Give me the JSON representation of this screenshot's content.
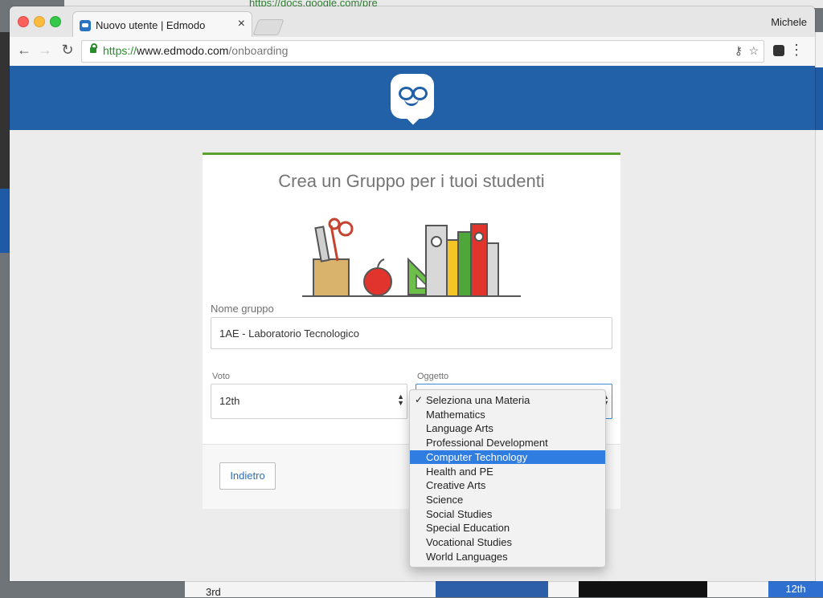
{
  "desktop": {
    "top_window_url": "https://docs.google.com/pre",
    "bottom_list_value": "3rd",
    "bottom_badge": "12th"
  },
  "browser": {
    "tab_title": "Nuovo utente | Edmodo",
    "profile_name": "Michele",
    "url_scheme": "https://",
    "url_host": "www.edmodo.com",
    "url_path": "/onboarding"
  },
  "page": {
    "title": "Crea un Gruppo per i tuoi studenti",
    "group_name_label": "Nome gruppo",
    "group_name_value": "1AE - Laboratorio Tecnologico",
    "grade_label": "Voto",
    "grade_value": "12th",
    "subject_label": "Oggetto",
    "back_button": "Indietro"
  },
  "subject_dropdown": {
    "checked_index": 0,
    "highlighted_index": 4,
    "options": [
      "Seleziona una Materia",
      "Mathematics",
      "Language Arts",
      "Professional Development",
      "Computer Technology",
      "Health and PE",
      "Creative Arts",
      "Science",
      "Social Studies",
      "Special Education",
      "Vocational Studies",
      "World Languages"
    ]
  },
  "colors": {
    "edmodo_blue": "#2260a8",
    "accent_green": "#5aa02c",
    "selection_blue": "#2f7de1"
  }
}
